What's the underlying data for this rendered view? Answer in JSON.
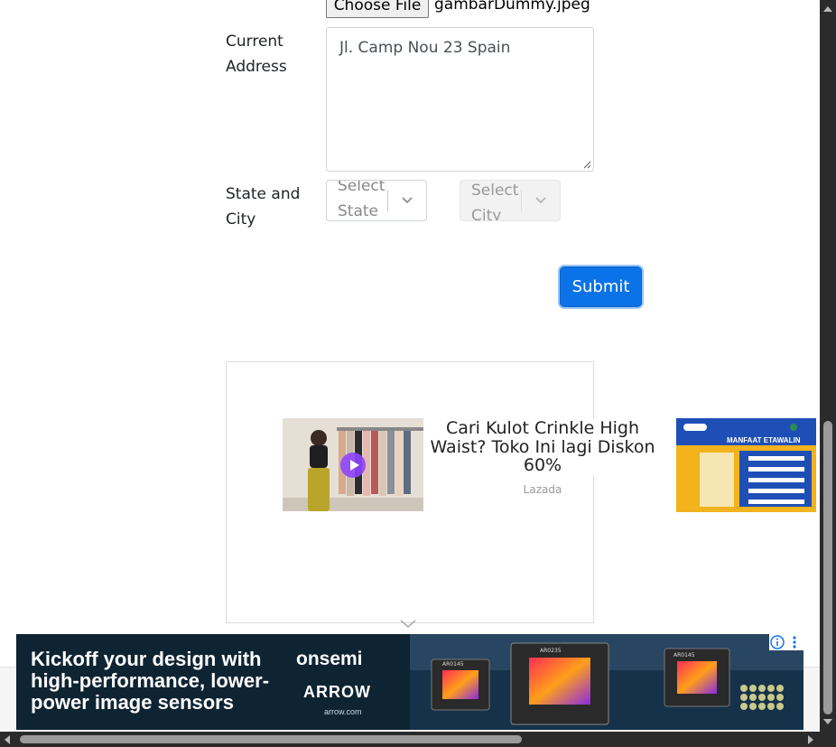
{
  "form": {
    "file_button_label": "Choose File",
    "file_name": "gambarDummy.jpeg",
    "address_label": "Current Address",
    "address_value": "Jl. Camp Nou 23 Spain",
    "state_city_label": "State and City",
    "state_placeholder": "Select State",
    "city_placeholder": "Select City",
    "submit_label": "Submit"
  },
  "native_ad": {
    "title": "Cari Kulot Crinkle High Waist? Toko Ini lagi Diskon 60%",
    "source": "Lazada",
    "right_thumb_heading": "MANFAAT ETAWALIN"
  },
  "banner_ad": {
    "headline": "Kickoff your design with high-performance, lower-power image sensors",
    "brand_primary": "onsemi",
    "brand_secondary": "ARROW",
    "url": "arrow.com",
    "chip_labels": [
      "AR0145",
      "AR0235",
      "AR0145"
    ]
  },
  "icons": {
    "chevron": "chevron-down-icon",
    "play": "play-icon",
    "info": "info-icon",
    "menu": "kebab-menu-icon"
  },
  "colors": {
    "submit_bg": "#0b72e7",
    "banner_bg": "#0f2433",
    "scrollbar": "#2b2b2b"
  }
}
